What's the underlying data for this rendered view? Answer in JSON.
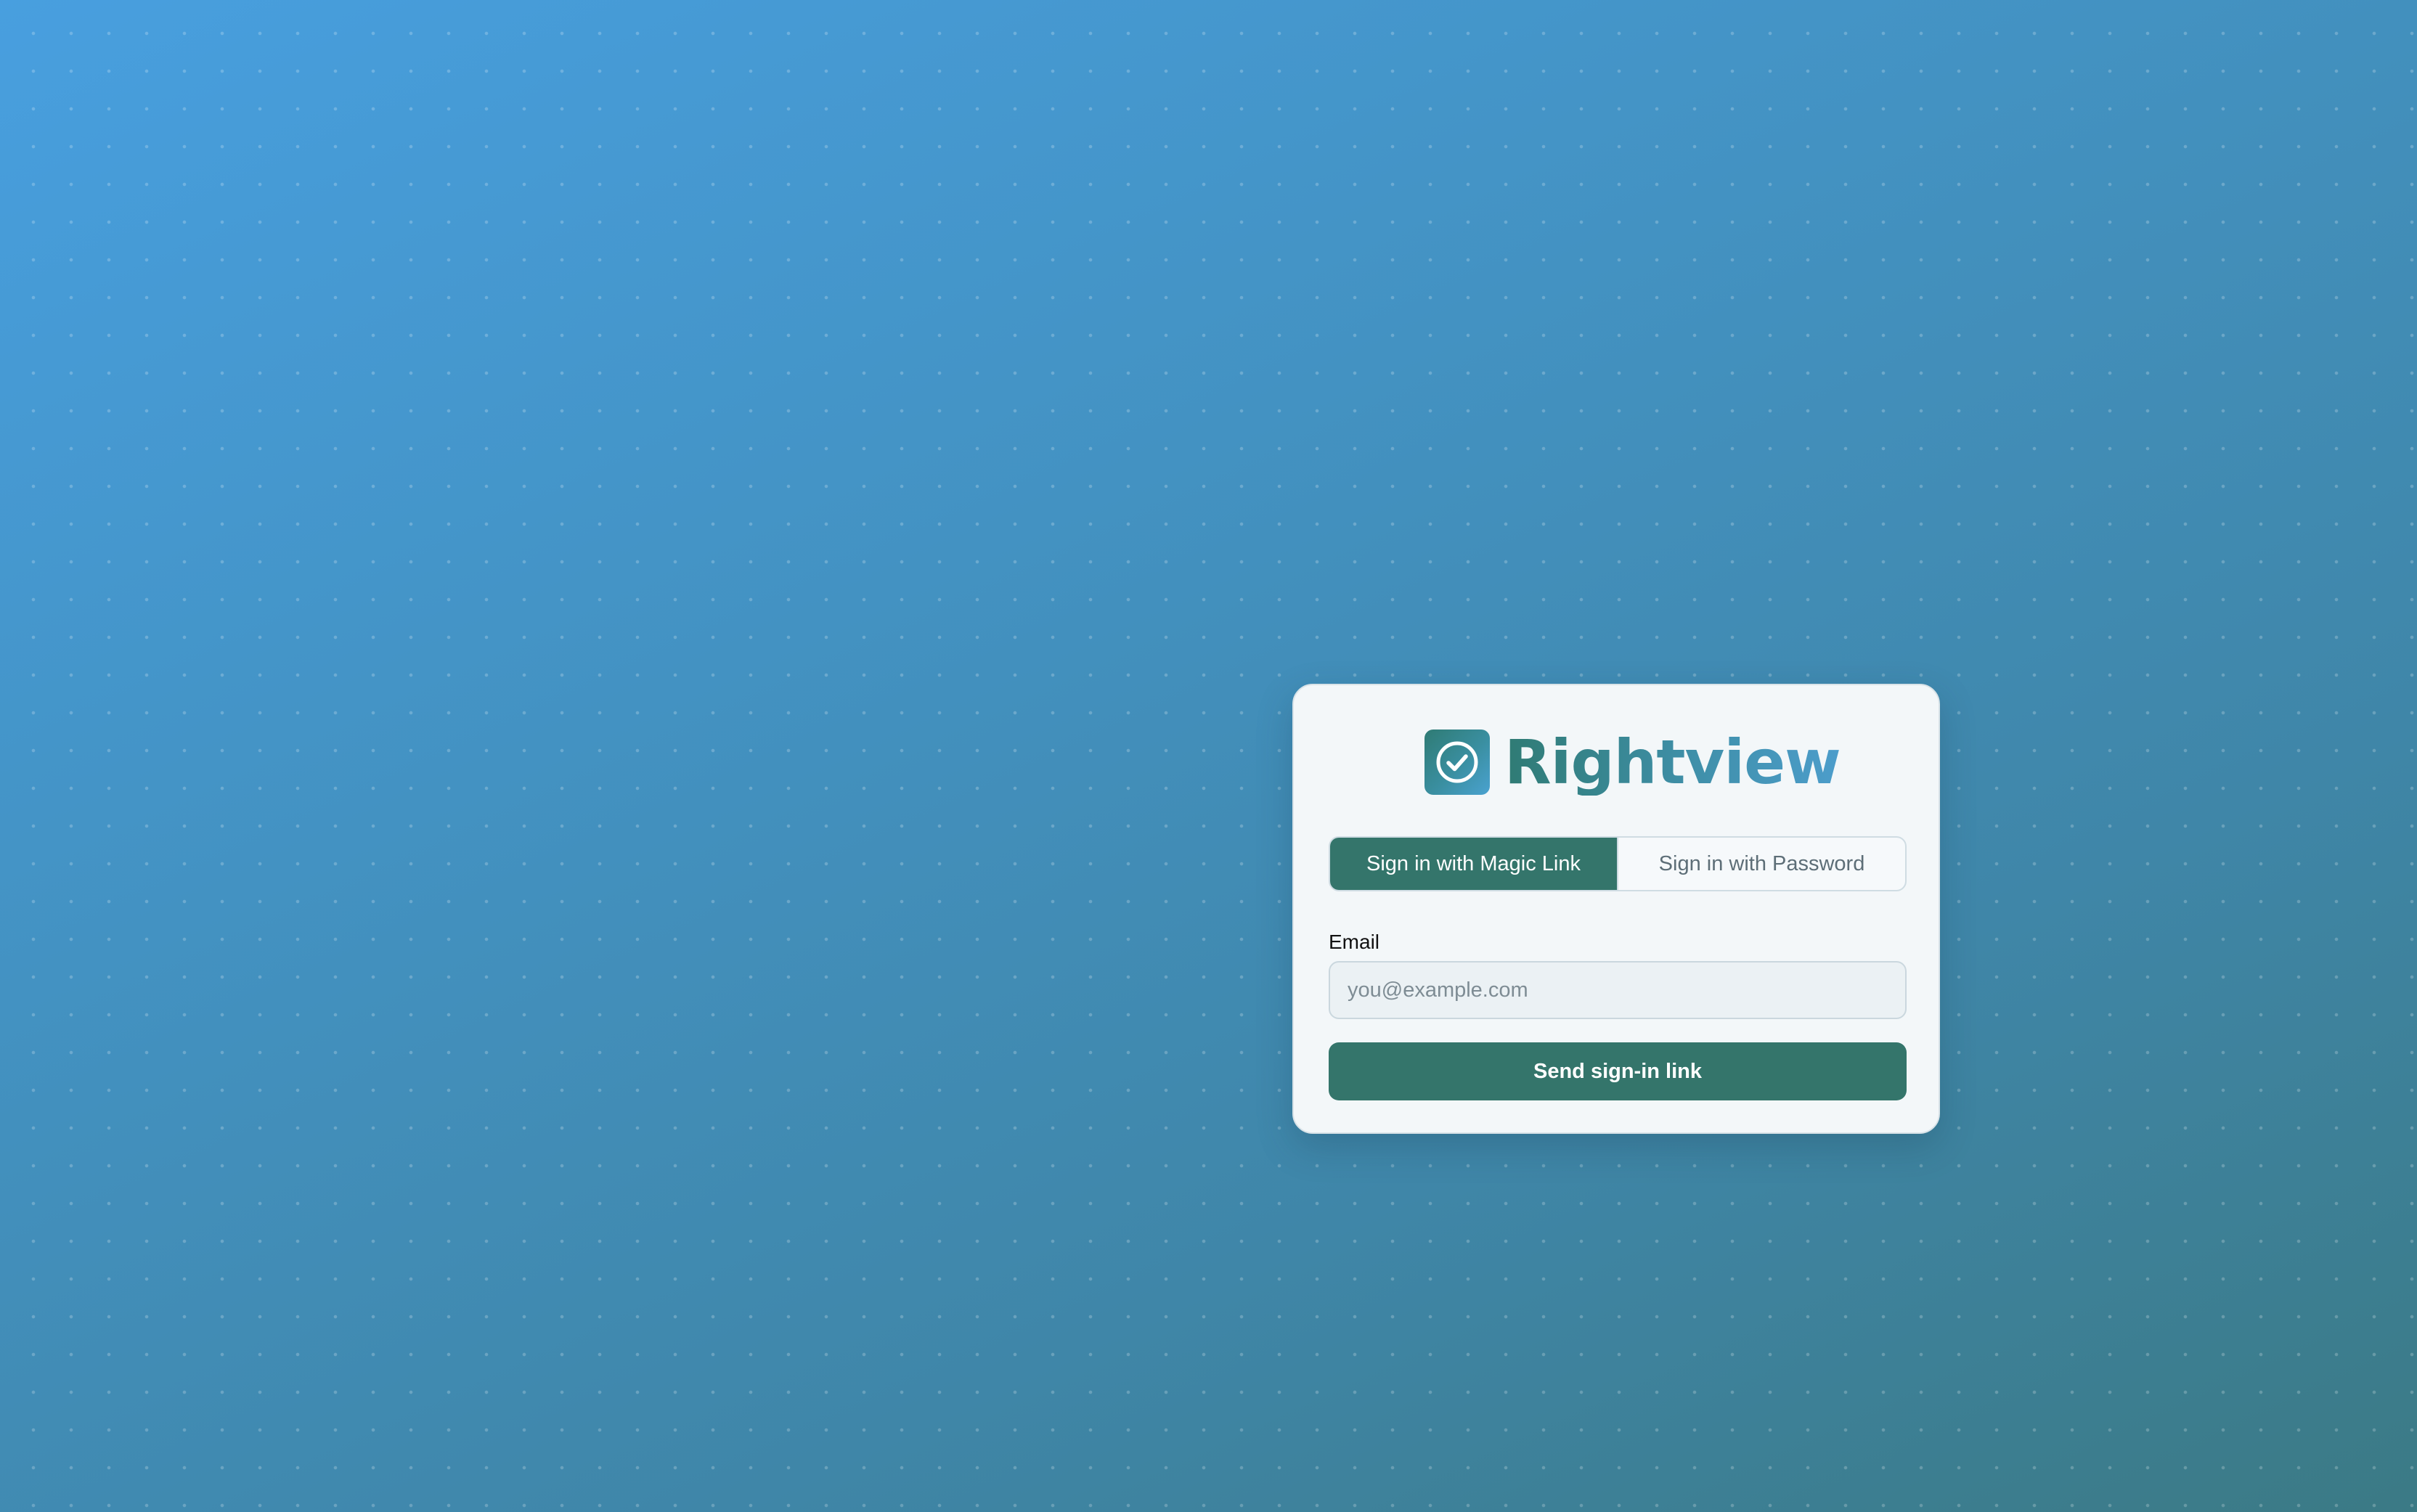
{
  "brand": {
    "name": "Rightview",
    "logo_icon": "check-circle-icon"
  },
  "signin_modes": {
    "tabs": [
      {
        "label": "Sign in with Magic Link",
        "active": true
      },
      {
        "label": "Sign in with Password",
        "active": false
      }
    ]
  },
  "form": {
    "email_label": "Email",
    "email_value": "",
    "email_placeholder": "you@example.com",
    "submit_label": "Send sign-in link"
  },
  "colors": {
    "primary": "#34756b",
    "card_background": "#f3f7f9",
    "page_gradient_start": "#489fdf",
    "page_gradient_end": "#3b7a85"
  }
}
